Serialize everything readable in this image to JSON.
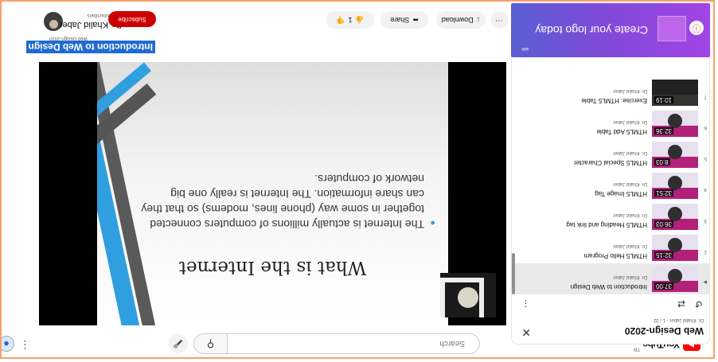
{
  "header": {
    "logo_text": "YouTube",
    "logo_country": "TR",
    "search_placeholder": "Search"
  },
  "video": {
    "title": "Introduction to Web Design",
    "meta": "Web Design-2020",
    "channel": "Dr. Khalid Jaber",
    "subscribers": "1.7K subscribers",
    "subscribe_label": "Subscribe",
    "like_count": "1",
    "share_label": "Share",
    "download_label": "Download"
  },
  "slide": {
    "title": "What is the Internet",
    "bullet": "The Internet is actually millions of computers connected together in some way (phone lines, modems) so that they can share information. The Internet is really one big network of computers."
  },
  "ad": {
    "text": "Create your logo today",
    "brand": "wix"
  },
  "playlist": {
    "title": "Web Design-2020",
    "subtitle": "Dr. Khalid Jaber - 1 / 32",
    "items": [
      {
        "index": "▶",
        "title": "Introduction to Web Design",
        "channel": "Dr. Khalid Jaber",
        "duration": "37:00"
      },
      {
        "index": "2",
        "title": "HTML5 Hello Program",
        "channel": "Dr. Khalid Jaber",
        "duration": "32:15"
      },
      {
        "index": "3",
        "title": "HTML5 Heading and link tag",
        "channel": "Dr. Khalid Jaber",
        "duration": "36:03"
      },
      {
        "index": "4",
        "title": "HTML5 Image Tag",
        "channel": "Dr. Khalid Jaber",
        "duration": "32:51"
      },
      {
        "index": "5",
        "title": "HTML5 Special Character",
        "channel": "Dr. Khalid Jaber",
        "duration": "8:03"
      },
      {
        "index": "6",
        "title": "HTML5 Add Table",
        "channel": "Dr. Khalid Jaber",
        "duration": "32:36"
      },
      {
        "index": "7",
        "title": "Exercise: HTML5 Table",
        "channel": "Dr. Khalid Jaber",
        "duration": "10:19"
      }
    ]
  }
}
